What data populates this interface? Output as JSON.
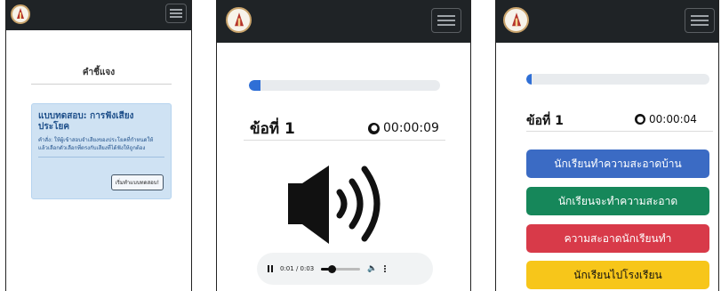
{
  "colors": {
    "navbar": "#1f2326",
    "progress": "#2f6fd6",
    "info_bg": "#cfe2f3",
    "choice_blue": "#3b6bc4",
    "choice_green": "#16875a",
    "choice_red": "#d83a49",
    "choice_yellow": "#f7c61a"
  },
  "panel1": {
    "title": "คำชี้แจง",
    "alert_heading": "แบบทดสอบ: การฟังเสียงประโยค",
    "alert_text": "คำสั่ง: ให้ผู้เข้าสอบจำเสียงของประโยคที่กำหนดให้ แล้วเลือกตัวเลือกที่ตรงกับเสียงที่ได้ฟังให้ถูกต้อง",
    "start_button": "เริ่มทำแบบทดสอบ!"
  },
  "panel2": {
    "progress_fraction": 0.06,
    "question_label": "ข้อที่ 1",
    "timer": "00:00:09",
    "speaker_icon": "speaker-volume-icon",
    "audio_time": "0:01 / 0:03"
  },
  "panel3": {
    "progress_fraction": 0.03,
    "question_label": "ข้อที่ 1",
    "timer": "00:00:04",
    "choices": [
      "นักเรียนทำความสะอาดบ้าน",
      "นักเรียนจะทำความสะอาด",
      "ความสะอาดนักเรียนทำ",
      "นักเรียนไปโรงเรียน"
    ]
  }
}
